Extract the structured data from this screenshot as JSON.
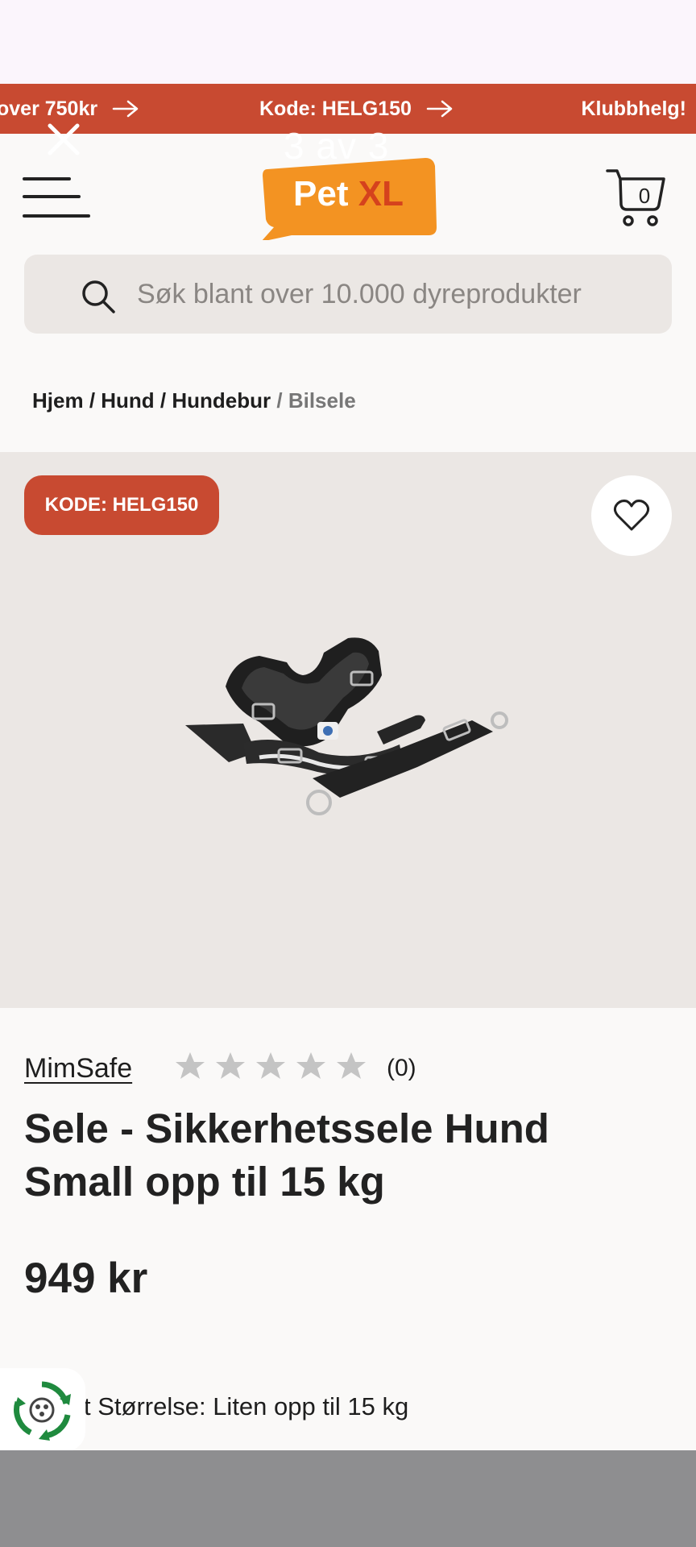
{
  "story": {
    "counter": "3 av 3"
  },
  "promo_bar": {
    "items": [
      {
        "text": "over 750kr"
      },
      {
        "text": "Kode: HELG150"
      },
      {
        "text": "Klubbhelg!"
      }
    ]
  },
  "header": {
    "logo": {
      "part1": "Pet",
      "part2": "XL"
    },
    "cart_count": "0"
  },
  "search": {
    "placeholder": "Søk blant over 10.000 dyreprodukter"
  },
  "breadcrumb": {
    "items": [
      "Hjem",
      "Hund",
      "Hundebur"
    ],
    "current": "Bilsele"
  },
  "product": {
    "badge": "KODE: HELG150",
    "brand": "MimSafe",
    "rating": {
      "stars": 0,
      "max": 5,
      "count_text": "(0)"
    },
    "title": "Sele - Sikkerhetssele Hund Small opp til 15 kg",
    "price": "949 kr",
    "variant_text": "t Størrelse: Liten opp til 15 kg"
  },
  "colors": {
    "accent": "#c84a31",
    "logo_orange": "#f39322",
    "logo_red": "#d5421d",
    "gallery_bg": "#ebe7e4",
    "star_grey": "#c4c4c4"
  },
  "icons": {
    "menu": "hamburger-icon",
    "cart": "cart-icon",
    "search": "search-icon",
    "wishlist": "heart-icon",
    "promo_arrow": "arrow-right-icon",
    "close": "close-icon",
    "recycle": "recycle-icon"
  }
}
